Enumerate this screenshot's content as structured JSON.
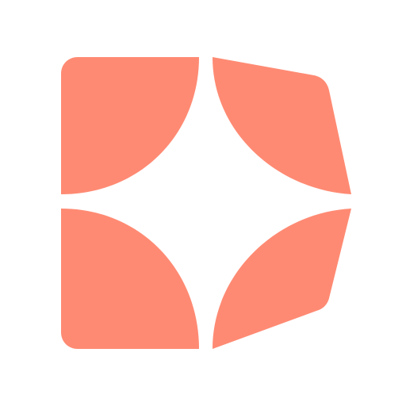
{
  "logo": {
    "icon": "four-petal-star-logo",
    "color": "#FF8A73",
    "background": "#FFFFFF"
  }
}
